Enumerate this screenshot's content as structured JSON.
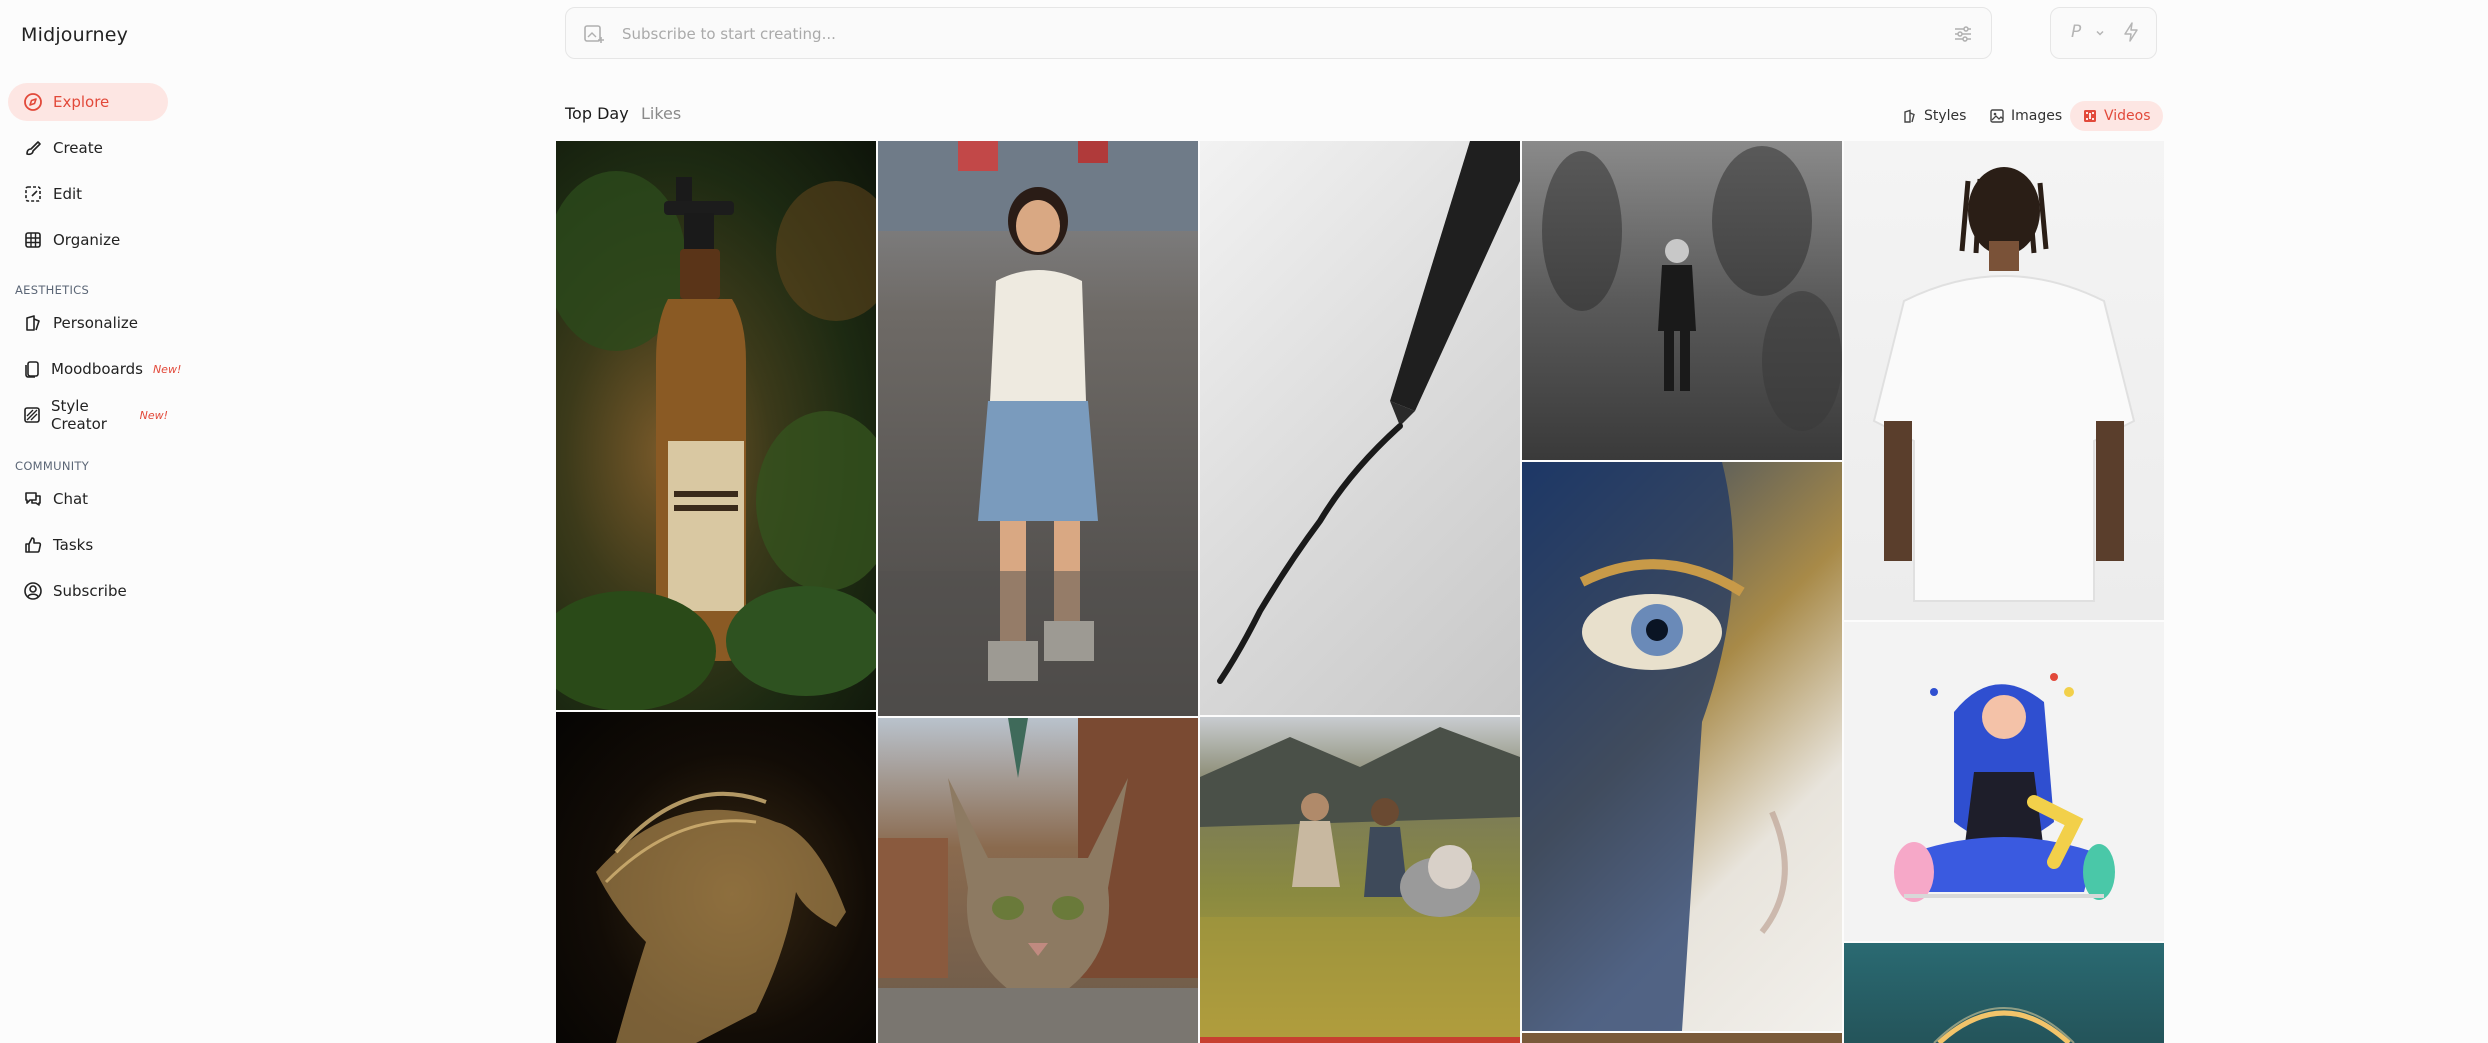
{
  "brand": "Midjourney",
  "nav": {
    "explore": "Explore",
    "create": "Create",
    "edit": "Edit",
    "organize": "Organize",
    "aesthetics_label": "AESTHETICS",
    "personalize": "Personalize",
    "moodboards": "Moodboards",
    "style_creator": "Style Creator",
    "new_badge": "New!",
    "community_label": "COMMUNITY",
    "chat": "Chat",
    "tasks": "Tasks",
    "subscribe": "Subscribe"
  },
  "search": {
    "placeholder": "Subscribe to start creating..."
  },
  "mode": {
    "letter": "P"
  },
  "tabs": {
    "top_day": "Top Day",
    "likes": "Likes"
  },
  "filters": {
    "styles": "Styles",
    "images": "Images",
    "videos": "Videos"
  },
  "colors": {
    "accent": "#e2493a",
    "accent_bg": "#fde6e3"
  }
}
